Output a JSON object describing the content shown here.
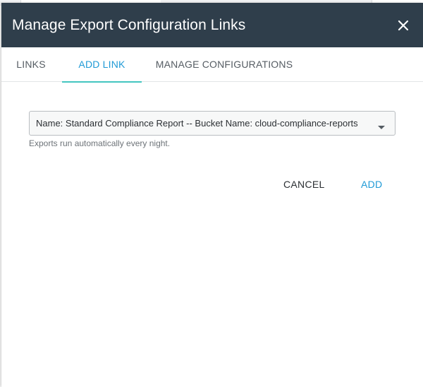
{
  "dialog": {
    "title": "Manage Export Configuration Links",
    "close_icon": "close-icon"
  },
  "tabs": [
    {
      "label": "LINKS",
      "active": false
    },
    {
      "label": "ADD LINK",
      "active": true
    },
    {
      "label": "MANAGE CONFIGURATIONS",
      "active": false
    }
  ],
  "form": {
    "select_value": "Name: Standard Compliance Report -- Bucket Name: cloud-compliance-reports",
    "select_icon": "caret-down-icon",
    "hint": "Exports run automatically every night."
  },
  "actions": {
    "cancel_label": "CANCEL",
    "add_label": "ADD"
  },
  "colors": {
    "header_bg": "#2f3e4b",
    "accent_blue": "#1f9ad6",
    "tab_underline": "#43c6c0"
  }
}
